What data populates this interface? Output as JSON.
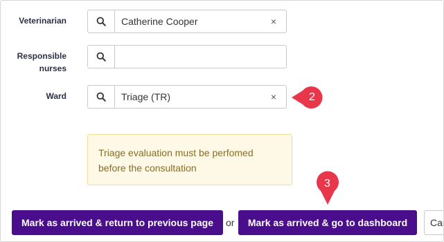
{
  "form": {
    "veterinarian": {
      "label": "Veterinarian",
      "value": "Catherine Cooper",
      "clear": "×"
    },
    "responsible_nurses": {
      "label_line1": "Responsible",
      "label_line2": "nurses",
      "value": ""
    },
    "ward": {
      "label": "Ward",
      "value": "Triage (TR)",
      "clear": "×"
    }
  },
  "callouts": {
    "ward": "2",
    "dashboard_button": "3",
    "color": "#e8364a"
  },
  "warning": {
    "line1": "Triage evaluation must be perfomed",
    "line2": "before the consultation"
  },
  "actions": {
    "return_label": "Mark as arrived & return to previous page",
    "or_label": "or",
    "dashboard_label": "Mark as arrived & go to dashboard",
    "cancel_label": "Cancel"
  },
  "colors": {
    "primary": "#4a0d8c",
    "warning_bg": "#fef9e6",
    "warning_text": "#8a6d1e"
  }
}
